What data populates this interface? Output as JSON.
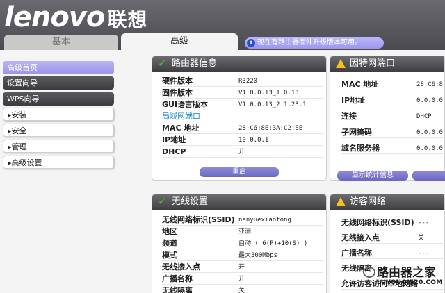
{
  "brand": {
    "logo": "lenovo",
    "logo_cn": "联想"
  },
  "tabs": {
    "basic": "基本",
    "advanced": "高级"
  },
  "notice": {
    "icon": "info-icon",
    "text": "现在有路由器固件升级版本可用。"
  },
  "sidebar": [
    {
      "label": "高级首页"
    },
    {
      "label": "设置向导"
    },
    {
      "label": "WPS向导"
    },
    {
      "label": "▸安装"
    },
    {
      "label": "▸安全"
    },
    {
      "label": "▸管理"
    },
    {
      "label": "▸高级设置"
    }
  ],
  "router_info": {
    "title": "路由器信息",
    "rows": [
      {
        "k": "硬件版本",
        "v": "R3220"
      },
      {
        "k": "固件版本",
        "v": "V1.0.0.13_1.0.13"
      },
      {
        "k": "GUI语言版本",
        "v": "V1.0.0.13_2.1.23.1"
      },
      {
        "k": "局域网端口",
        "v": ""
      },
      {
        "k": "MAC 地址",
        "v": "28:C6:8E:3A:C2:EE"
      },
      {
        "k": "IP地址",
        "v": "10.0.0.1"
      },
      {
        "k": "DHCP",
        "v": "开"
      }
    ],
    "button": "重启"
  },
  "internet_port": {
    "title": "因特网端口",
    "rows": [
      {
        "k": "MAC 地址",
        "v": "28:C6:8"
      },
      {
        "k": "IP地址",
        "v": "0.0.0.0"
      },
      {
        "k": "连接",
        "v": "DHCP"
      },
      {
        "k": "子网掩码",
        "v": "0.0.0.0"
      },
      {
        "k": "域名服务器",
        "v": "0.0.0.0"
      }
    ],
    "button": "显示统计信息"
  },
  "wireless": {
    "title": "无线设置",
    "rows": [
      {
        "k": "无线网络标识(SSID)",
        "v": "nanyuexiaotong"
      },
      {
        "k": "地区",
        "v": "亚洲"
      },
      {
        "k": "频道",
        "v": "自动 ( 6(P)+10(S) )"
      },
      {
        "k": "模式",
        "v": "最大300Mbps"
      },
      {
        "k": "无线接入点",
        "v": "开"
      },
      {
        "k": "广播名称",
        "v": "开"
      },
      {
        "k": "无线隔离",
        "v": "关"
      }
    ]
  },
  "guest": {
    "title": "访客网络",
    "rows": [
      {
        "k": "无线网络标识(SSID)",
        "v": "---"
      },
      {
        "k": "无线接入点",
        "v": "关"
      },
      {
        "k": "广播名称",
        "v": "---"
      },
      {
        "k": "无线隔离",
        "v": ""
      },
      {
        "k": "允许访客访问本地网络",
        "v": ""
      }
    ]
  },
  "watermark": {
    "cn": "路由器之家",
    "url": "LUYOUQI520.COM"
  }
}
